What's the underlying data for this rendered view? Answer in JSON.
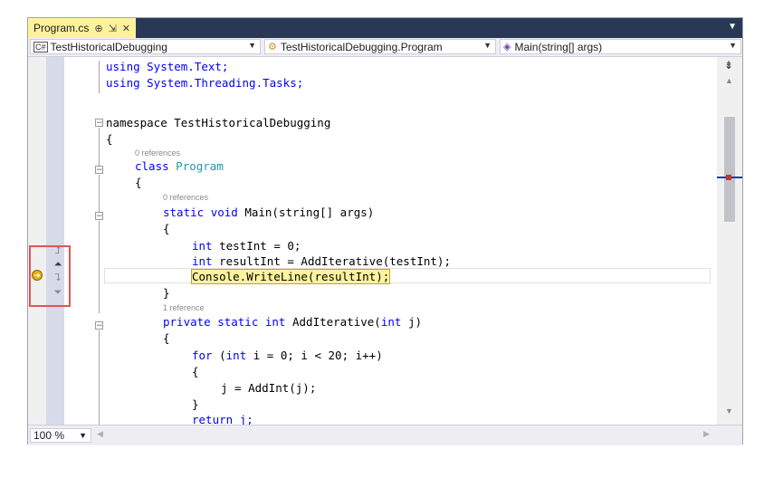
{
  "tab": {
    "title": "Program.cs",
    "pin_glyph": "⊕",
    "pin2_glyph": "⇲",
    "close_glyph": "✕"
  },
  "nav": {
    "project": "TestHistoricalDebugging",
    "type": "TestHistoricalDebugging.Program",
    "member": "Main(string[] args)"
  },
  "code": {
    "lines": [
      {
        "text": "using System.Text;"
      },
      {
        "text": "using System.Threading.Tasks;"
      },
      {
        "text": "namespace TestHistoricalDebugging"
      },
      {
        "text": "{"
      },
      {
        "text": "0 references"
      },
      {
        "text": "class"
      },
      {
        "text": "Program"
      },
      {
        "text": "{"
      },
      {
        "text": "0 references"
      },
      {
        "text": "static"
      },
      {
        "text": "void"
      },
      {
        "text": "Main(string[] args)"
      },
      {
        "text": "{"
      },
      {
        "text": "int"
      },
      {
        "text": "testInt = 0;"
      },
      {
        "text": "int"
      },
      {
        "text": "resultInt = AddIterative(testInt);"
      },
      {
        "text": "Console.WriteLine(resultInt);"
      },
      {
        "text": "}"
      },
      {
        "text": "1 reference"
      },
      {
        "text": "private static int"
      },
      {
        "text": "AddIterative("
      },
      {
        "text": "int"
      },
      {
        "text": "j)"
      },
      {
        "text": "{"
      },
      {
        "text": "for"
      },
      {
        "text": "("
      },
      {
        "text": "int"
      },
      {
        "text": "i = 0; i < 20; i++)"
      },
      {
        "text": "{"
      },
      {
        "text": "j = AddInt(j);"
      },
      {
        "text": "}"
      },
      {
        "text": "return j;"
      }
    ]
  },
  "status": {
    "zoom": "100 %"
  },
  "colors": {
    "accent_tab": "#fff29d",
    "tabbar": "#293955",
    "highlight_box": "#e05555"
  }
}
